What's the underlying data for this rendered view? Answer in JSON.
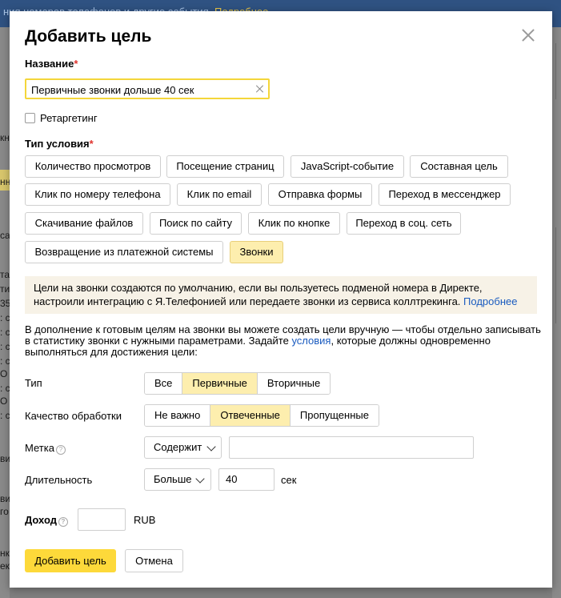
{
  "background": {
    "topbar_text": "ния номеров телефонов и другие события.",
    "topbar_link": "Подробнее",
    "left_fragments": [
      "кн",
      "нн",
      "са",
      "та",
      "ти",
      "35",
      ": с",
      ": с",
      ": с",
      ": с",
      "О",
      ": с",
      "О",
      ": с",
      "ви",
      "ви",
      "го",
      "нк",
      "ек"
    ]
  },
  "modal": {
    "title": "Добавить цель",
    "name_label": "Название",
    "required_mark": "*",
    "name_value": "Первичные звонки дольше 40 сек",
    "retargeting_label": "Ретаргетинг",
    "condition_label": "Тип условия",
    "condition_types": [
      "Количество просмотров",
      "Посещение страниц",
      "JavaScript-событие",
      "Составная цель",
      "Клик по номеру телефона",
      "Клик по email",
      "Отправка формы",
      "Переход в мессенджер",
      "Скачивание файлов",
      "Поиск по сайту",
      "Клик по кнопке",
      "Переход в соц. сеть",
      "Возвращение из платежной системы",
      "Звонки"
    ],
    "selected_condition": "Звонки",
    "info_text": "Цели на звонки создаются по умолчанию, если вы пользуетесь подменой номера в Директе, настроили интеграцию с Я.Телефонией или передаете звонки из сервиса коллтрекинга.",
    "info_link": "Подробнее",
    "desc_text_1": "В дополнение к готовым целям на звонки вы можете создать цели вручную — чтобы отдельно записывать в статистику звонки с нужными параметрами. Задайте",
    "desc_link": "условия",
    "desc_text_2": ", которые должны одновременно выполняться для достижения цели:",
    "type_label": "Тип",
    "type_options": [
      "Все",
      "Первичные",
      "Вторичные"
    ],
    "type_selected": "Первичные",
    "quality_label": "Качество обработки",
    "quality_options": [
      "Не важно",
      "Отвеченные",
      "Пропущенные"
    ],
    "quality_selected": "Отвеченные",
    "tag_label": "Метка",
    "help_glyph": "?",
    "tag_operator": "Содержит",
    "tag_value": "",
    "duration_label": "Длительность",
    "duration_operator": "Больше",
    "duration_value": "40",
    "duration_unit": "сек",
    "income_label": "Доход",
    "income_value": "",
    "income_currency": "RUB",
    "submit_label": "Добавить цель",
    "cancel_label": "Отмена"
  }
}
